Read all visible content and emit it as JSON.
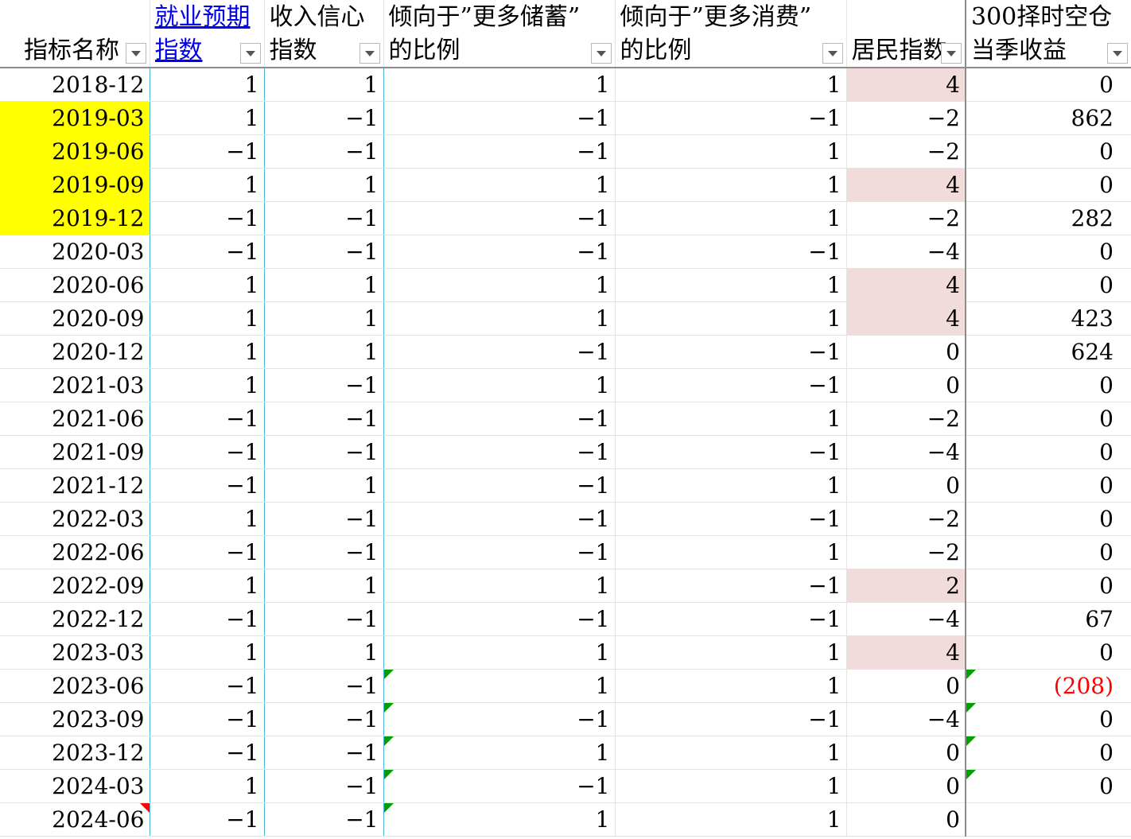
{
  "headers": [
    {
      "line1": "",
      "line2": "指标名称",
      "link": false,
      "filter": true
    },
    {
      "line1": "就业预期",
      "line2": "指数",
      "link": true,
      "filter": true
    },
    {
      "line1": "收入信心",
      "line2": "指数",
      "link": false,
      "filter": true
    },
    {
      "line1": "倾向于”更多储蓄”",
      "line2": "的比例",
      "link": false,
      "filter": true
    },
    {
      "line1": "倾向于”更多消费”",
      "line2": "的比例",
      "link": false,
      "filter": true
    },
    {
      "line1": "",
      "line2": "居民指数",
      "link": false,
      "filter": true
    },
    {
      "line1": "300择时空仓",
      "line2": "当季收益",
      "link": false,
      "filter": true
    }
  ],
  "rows": [
    {
      "date": "2018-12",
      "v": [
        "1",
        "1",
        "1",
        "1",
        "4",
        "0"
      ]
    },
    {
      "date": "2019-03",
      "v": [
        "1",
        "−1",
        "−1",
        "−1",
        "−2",
        "862"
      ]
    },
    {
      "date": "2019-06",
      "v": [
        "−1",
        "−1",
        "−1",
        "1",
        "−2",
        "0"
      ]
    },
    {
      "date": "2019-09",
      "v": [
        "1",
        "1",
        "1",
        "1",
        "4",
        "0"
      ]
    },
    {
      "date": "2019-12",
      "v": [
        "−1",
        "−1",
        "−1",
        "1",
        "−2",
        "282"
      ]
    },
    {
      "date": "2020-03",
      "v": [
        "−1",
        "−1",
        "−1",
        "−1",
        "−4",
        "0"
      ]
    },
    {
      "date": "2020-06",
      "v": [
        "1",
        "1",
        "1",
        "1",
        "4",
        "0"
      ]
    },
    {
      "date": "2020-09",
      "v": [
        "1",
        "1",
        "1",
        "1",
        "4",
        "423"
      ]
    },
    {
      "date": "2020-12",
      "v": [
        "1",
        "1",
        "−1",
        "−1",
        "0",
        "624"
      ]
    },
    {
      "date": "2021-03",
      "v": [
        "1",
        "−1",
        "1",
        "−1",
        "0",
        "0"
      ]
    },
    {
      "date": "2021-06",
      "v": [
        "−1",
        "−1",
        "−1",
        "1",
        "−2",
        "0"
      ]
    },
    {
      "date": "2021-09",
      "v": [
        "−1",
        "−1",
        "−1",
        "−1",
        "−4",
        "0"
      ]
    },
    {
      "date": "2021-12",
      "v": [
        "−1",
        "1",
        "−1",
        "1",
        "0",
        "0"
      ]
    },
    {
      "date": "2022-03",
      "v": [
        "1",
        "−1",
        "−1",
        "−1",
        "−2",
        "0"
      ]
    },
    {
      "date": "2022-06",
      "v": [
        "−1",
        "−1",
        "−1",
        "1",
        "−2",
        "0"
      ]
    },
    {
      "date": "2022-09",
      "v": [
        "1",
        "1",
        "1",
        "−1",
        "2",
        "0"
      ]
    },
    {
      "date": "2022-12",
      "v": [
        "−1",
        "−1",
        "−1",
        "−1",
        "−4",
        "67"
      ]
    },
    {
      "date": "2023-03",
      "v": [
        "1",
        "1",
        "1",
        "1",
        "4",
        "0"
      ]
    },
    {
      "date": "2023-06",
      "v": [
        "−1",
        "−1",
        "1",
        "1",
        "0",
        "(208)"
      ]
    },
    {
      "date": "2023-09",
      "v": [
        "−1",
        "−1",
        "−1",
        "−1",
        "−4",
        "0"
      ]
    },
    {
      "date": "2023-12",
      "v": [
        "−1",
        "−1",
        "1",
        "1",
        "0",
        "0"
      ]
    },
    {
      "date": "2024-03",
      "v": [
        "1",
        "−1",
        "−1",
        "1",
        "0",
        "0"
      ]
    },
    {
      "date": "2024-06",
      "v": [
        "−1",
        "−1",
        "1",
        "1",
        "0",
        ""
      ]
    }
  ],
  "highlights": {
    "yellow_dates": [
      "2019-03",
      "2019-06",
      "2019-09",
      "2019-12"
    ],
    "pink_index_values": [
      "4",
      "2"
    ],
    "yellow_color": "#ffff00",
    "pink_color": "#f2dcdb",
    "negative_color": "#ff0000",
    "link_color": "#0000ee"
  },
  "cell_markers": {
    "green_triangle_rows_col3": [
      "2023-06",
      "2023-09",
      "2023-12",
      "2024-03",
      "2024-06"
    ],
    "green_triangle_rows_col6": [
      "2023-06",
      "2023-09",
      "2023-12",
      "2024-03"
    ],
    "red_triangle_rows_col0": [
      "2024-06"
    ]
  }
}
